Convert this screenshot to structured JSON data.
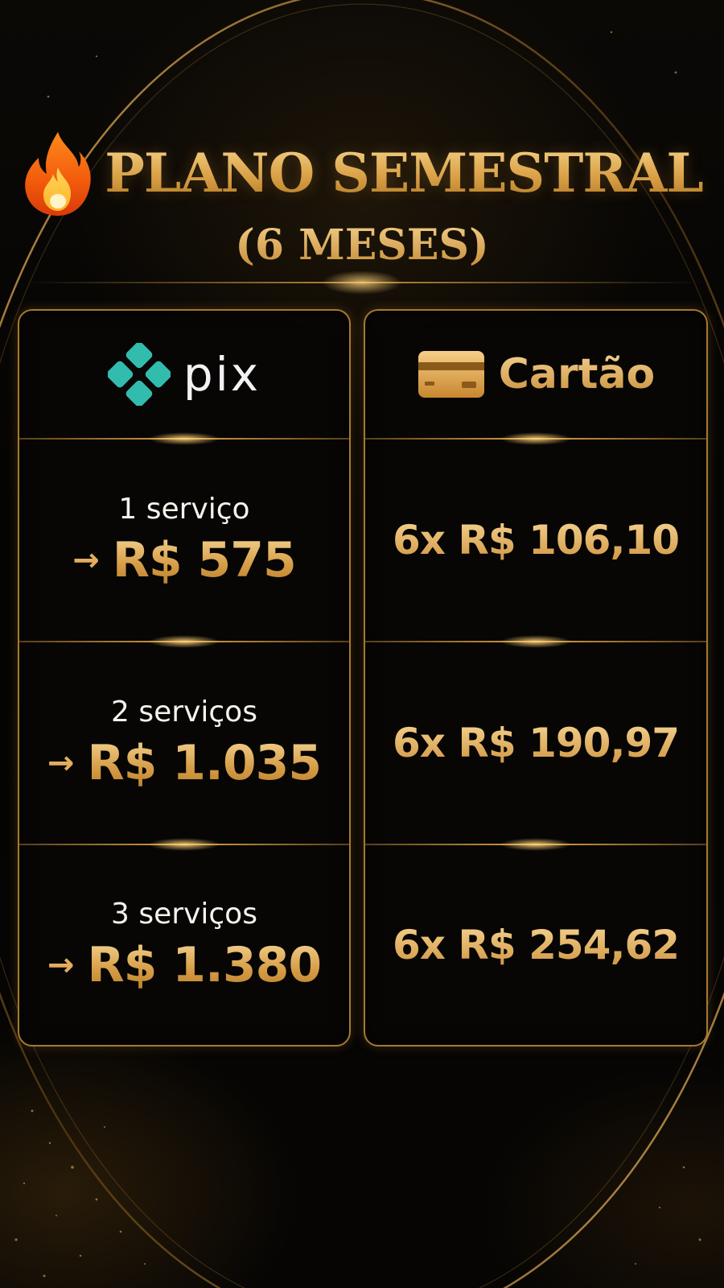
{
  "header": {
    "title": "PLANO SEMESTRAL",
    "subtitle": "(6 MESES)",
    "title_icon": "fire-icon"
  },
  "colors": {
    "gold": "#e2b35a",
    "background": "#050403",
    "pix_teal": "#32bcad",
    "white": "#f5f2ea"
  },
  "pix": {
    "logo_icon": "pix-logo-icon",
    "label": "pix",
    "rows": [
      {
        "service": "1 serviço",
        "arrow": "→",
        "price": "R$ 575"
      },
      {
        "service": "2 serviços",
        "arrow": "→",
        "price": "R$ 1.035"
      },
      {
        "service": "3 serviços",
        "arrow": "→",
        "price": "R$ 1.380"
      }
    ]
  },
  "card": {
    "icon": "credit-card-icon",
    "label": "Cartão",
    "rows": [
      {
        "price": "6x R$ 106,10"
      },
      {
        "price": "6x R$ 190,97"
      },
      {
        "price": "6x R$ 254,62"
      }
    ]
  }
}
